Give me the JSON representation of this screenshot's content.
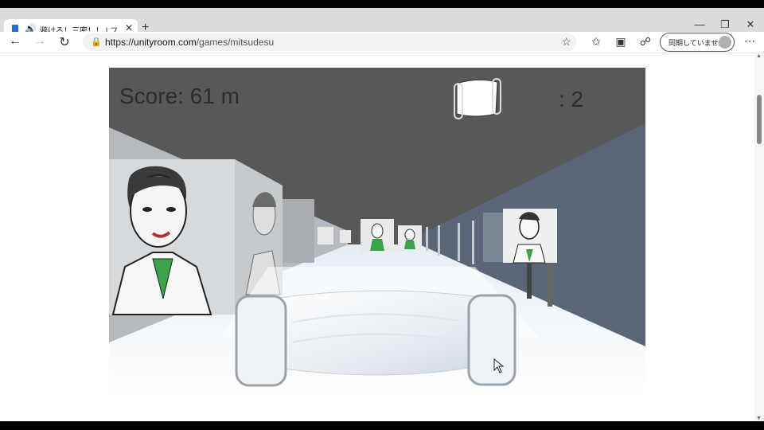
{
  "browser": {
    "tab": {
      "title": "避けろ！三密！！ | フリーゲーム",
      "audio_icon": "speaker-icon",
      "close_icon": "close-icon"
    },
    "new_tab_icon": "plus-icon",
    "window_controls": [
      "minimize-icon",
      "restore-icon",
      "close-icon"
    ],
    "nav": {
      "back_icon": "back-arrow-icon",
      "forward_icon": "forward-arrow-icon",
      "reload_icon": "reload-icon"
    },
    "url": {
      "prefix": "https://",
      "host": "unityroom.com",
      "path": "/games/mitsudesu"
    },
    "toolbar_icons": [
      "favorites-icon",
      "collections-icon",
      "feedback-icon"
    ],
    "sync_label": "同期していません",
    "more_icon": "more-icon"
  },
  "game": {
    "score_text": "Score: 61 m",
    "mask_count_text": ": 2",
    "colors": {
      "ceiling": "#585858",
      "floor": "#f4f8fb",
      "wall_left": "#c8ccd0",
      "wall_right": "#5a6577"
    }
  }
}
